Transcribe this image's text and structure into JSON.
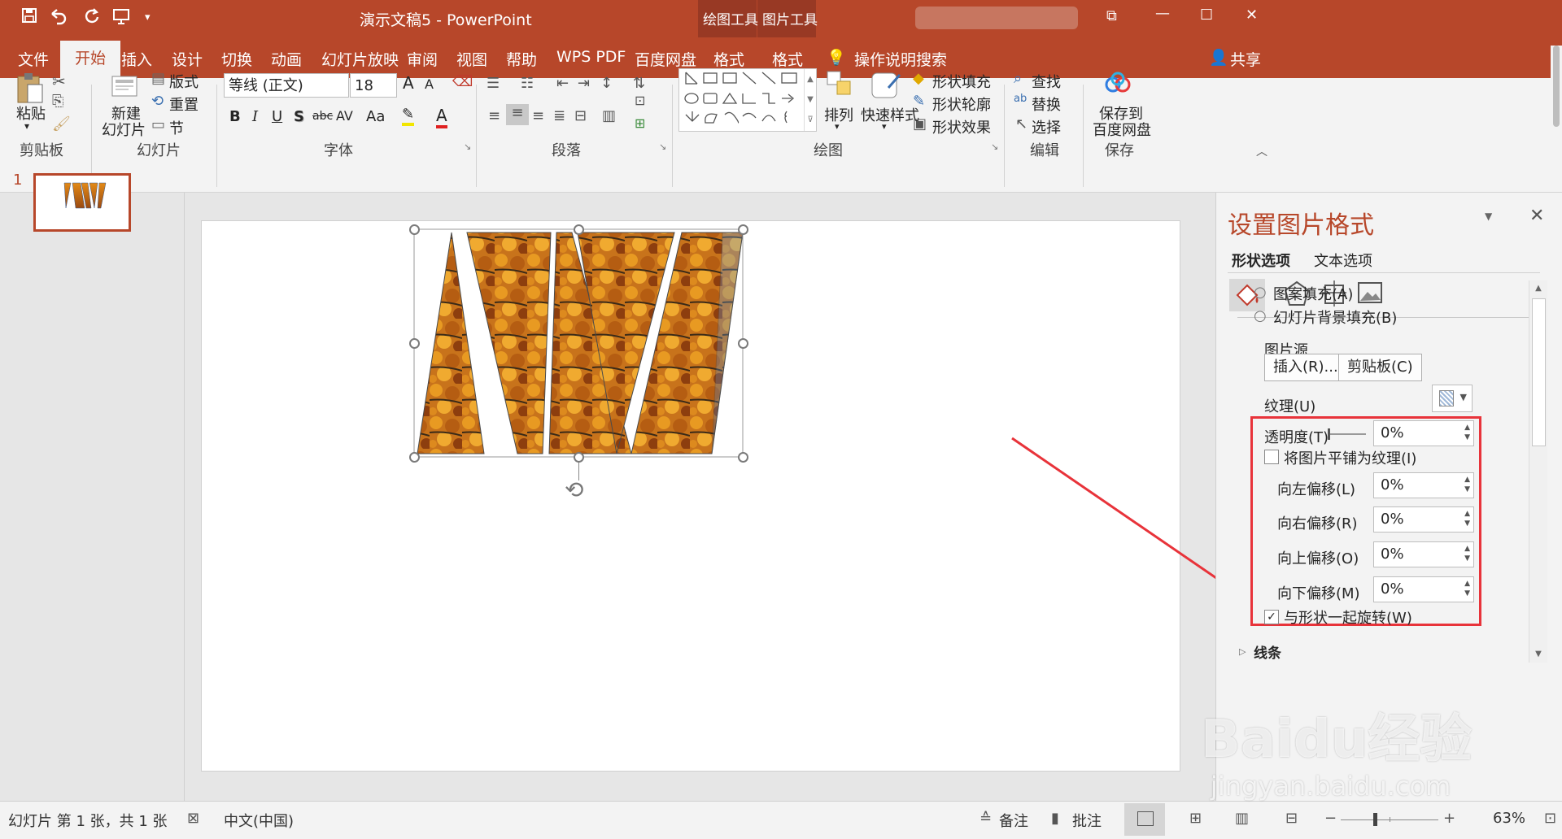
{
  "window": {
    "title": "演示文稿5  -  PowerPoint",
    "context_tool_1": "绘图工具",
    "context_tool_2": "图片工具",
    "restore_label": "⧉",
    "minimize_label": "—",
    "maximize_label": "☐",
    "close_label": "✕"
  },
  "tabs": [
    "文件",
    "开始",
    "插入",
    "设计",
    "切换",
    "动画",
    "幻灯片放映",
    "审阅",
    "视图",
    "帮助",
    "WPS PDF",
    "百度网盘",
    "格式",
    "格式"
  ],
  "tell_me": "操作说明搜索",
  "share": "共享",
  "ribbon": {
    "clipboard": {
      "paste": "粘贴",
      "label": "剪贴板"
    },
    "slides": {
      "new_slide_1": "新建",
      "new_slide_2": "幻灯片",
      "layout": "版式",
      "reset": "重置",
      "section": "节",
      "label": "幻灯片"
    },
    "font": {
      "name": "等线 (正文)",
      "size": "18",
      "bold": "B",
      "italic": "I",
      "underline": "U",
      "shadow": "S",
      "strike": "abc",
      "spacing": "AV",
      "case": "Aa",
      "grow": "A",
      "shrink": "A",
      "label": "字体"
    },
    "paragraph": {
      "label": "段落"
    },
    "drawing": {
      "arrange": "排列",
      "quick_styles": "快速样式",
      "shape_fill": "形状填充",
      "shape_outline": "形状轮廓",
      "shape_effects": "形状效果",
      "label": "绘图"
    },
    "editing": {
      "find": "查找",
      "replace": "替换",
      "select": "选择",
      "label": "编辑"
    },
    "save": {
      "line1": "保存到",
      "line2": "百度网盘",
      "label": "保存"
    }
  },
  "thumbnails": [
    {
      "number": "1"
    }
  ],
  "format_pane": {
    "title": "设置图片格式",
    "tab_shape": "形状选项",
    "tab_text": "文本选项",
    "pattern_fill": "图案填充(A)",
    "slide_bg_fill": "幻灯片背景填充(B)",
    "picture_source": "图片源",
    "insert_btn": "插入(R)...",
    "clipboard_btn": "剪贴板(C)",
    "texture": "纹理(U)",
    "transparency": {
      "label": "透明度(T)",
      "value": "0%"
    },
    "tile_checkbox": "将图片平铺为纹理(I)",
    "offset_left": {
      "label": "向左偏移(L)",
      "value": "0%"
    },
    "offset_right": {
      "label": "向右偏移(R)",
      "value": "0%"
    },
    "offset_top": {
      "label": "向上偏移(O)",
      "value": "0%"
    },
    "offset_bottom": {
      "label": "向下偏移(M)",
      "value": "0%"
    },
    "rotate_with_shape": "与形状一起旋转(W)",
    "line_section": "线条"
  },
  "status": {
    "slide_info": "幻灯片 第 1 张，共 1 张",
    "language": "中文(中国)",
    "notes": "备注",
    "comments": "批注",
    "zoom": "63%"
  },
  "watermark": {
    "line1": "Baidu经验",
    "line2": "jingyan.baidu.com"
  },
  "colors": {
    "accent": "#b7472a",
    "highlight_box": "#e8333a",
    "arrow": "#e8333a"
  }
}
